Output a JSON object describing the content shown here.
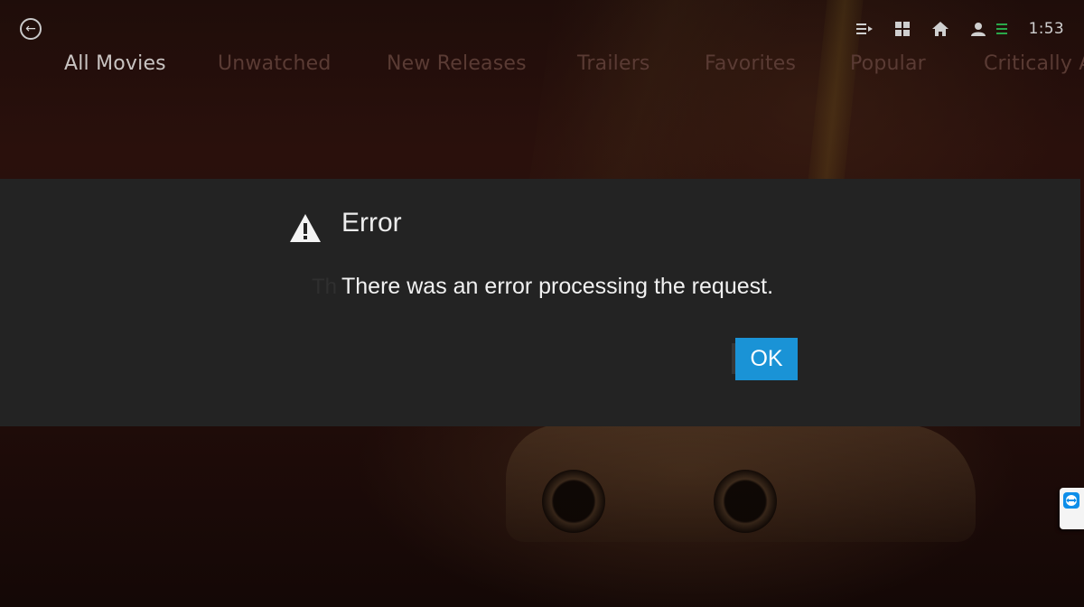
{
  "header": {
    "back_icon": "back-arrow-circle-icon",
    "toolbar_icons": [
      "queue-list-icon",
      "grid-icon",
      "home-icon",
      "user-icon",
      "menu-icon"
    ],
    "clock": "1:53"
  },
  "tabs": [
    {
      "label": "All Movies",
      "active": true
    },
    {
      "label": "Unwatched",
      "active": false
    },
    {
      "label": "New Releases",
      "active": false
    },
    {
      "label": "Trailers",
      "active": false
    },
    {
      "label": "Favorites",
      "active": false
    },
    {
      "label": "Popular",
      "active": false
    },
    {
      "label": "Critically A",
      "active": false
    }
  ],
  "dialog": {
    "icon": "warning-triangle-icon",
    "title": "Error",
    "ghost_text": "Th",
    "message": "There was an error processing the request.",
    "ok_label": "OK"
  },
  "side_widget": {
    "icon": "remote-support-icon"
  },
  "colors": {
    "dialog_bg": "#232323",
    "accent": "#1a93d6",
    "menu_icon": "#2aa84a",
    "tab_active": "#c9c4c2",
    "tab_inactive": "#5a3b34"
  }
}
